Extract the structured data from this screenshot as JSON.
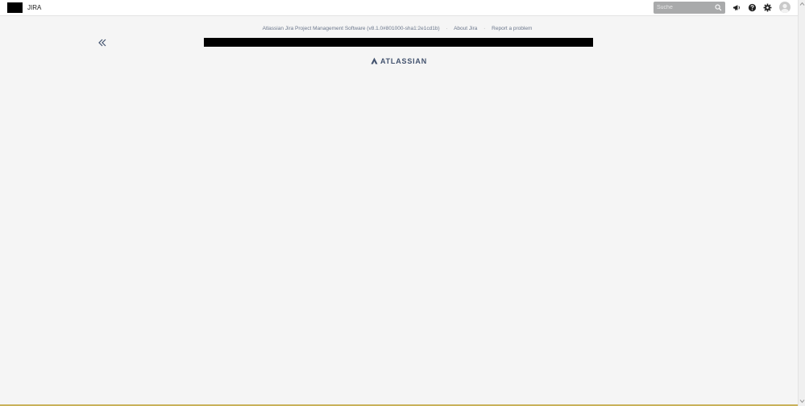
{
  "header": {
    "app_name": "JIRA",
    "search": {
      "placeholder": "Suche",
      "value": ""
    },
    "icons": [
      "announcement-icon",
      "help-icon",
      "settings-icon",
      "avatar"
    ]
  },
  "footer": {
    "software_info": "Atlassian Jira Project Management Software (v8.1.0#801000-sha1:2e1cd1b)",
    "about": "About Jira",
    "report": "Report a problem",
    "separator": "·",
    "brand": "ATLASSIAN"
  },
  "colors": {
    "page_bg": "#f5f5f5",
    "header_bg": "#ffffff",
    "search_bg": "#a9aaab",
    "brand": "#42526e",
    "link": "#6b778c"
  }
}
